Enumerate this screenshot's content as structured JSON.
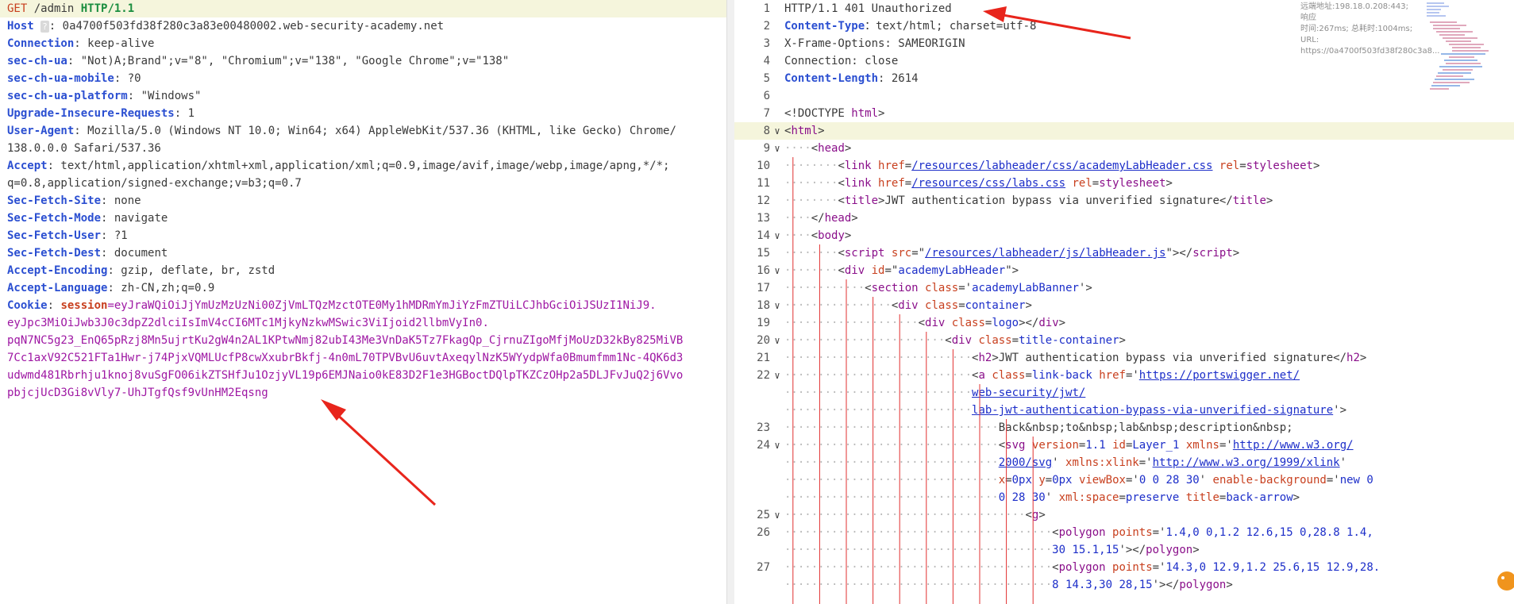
{
  "request": {
    "lines": [
      {
        "type": "reqline",
        "method": "GET",
        "path": " /admin ",
        "proto": "HTTP/1.1"
      },
      {
        "type": "host",
        "key": "Host",
        "badge": "?",
        "value": ": 0a4700f503fd38f280c3a83e00480002.web-security-academy.net"
      },
      {
        "type": "header",
        "key": "Connection",
        "value": ": keep-alive"
      },
      {
        "type": "header",
        "key": "sec-ch-ua",
        "value": ": \"Not)A;Brand\";v=\"8\", \"Chromium\";v=\"138\", \"Google Chrome\";v=\"138\""
      },
      {
        "type": "header",
        "key": "sec-ch-ua-mobile",
        "value": ": ?0"
      },
      {
        "type": "header",
        "key": "sec-ch-ua-platform",
        "value": ": \"Windows\""
      },
      {
        "type": "header",
        "key": "Upgrade-Insecure-Requests",
        "value": ": 1"
      },
      {
        "type": "header",
        "key": "User-Agent",
        "value": ": Mozilla/5.0 (Windows NT 10.0; Win64; x64) AppleWebKit/537.36 (KHTML, like Gecko) Chrome/"
      },
      {
        "type": "cont",
        "value": "138.0.0.0 Safari/537.36"
      },
      {
        "type": "header",
        "key": "Accept",
        "value": ": text/html,application/xhtml+xml,application/xml;q=0.9,image/avif,image/webp,image/apng,*/*;"
      },
      {
        "type": "cont",
        "value": "q=0.8,application/signed-exchange;v=b3;q=0.7"
      },
      {
        "type": "header",
        "key": "Sec-Fetch-Site",
        "value": ": none"
      },
      {
        "type": "header",
        "key": "Sec-Fetch-Mode",
        "value": ": navigate"
      },
      {
        "type": "header",
        "key": "Sec-Fetch-User",
        "value": ": ?1"
      },
      {
        "type": "header",
        "key": "Sec-Fetch-Dest",
        "value": ": document"
      },
      {
        "type": "header",
        "key": "Accept-Encoding",
        "value": ": gzip, deflate, br, zstd"
      },
      {
        "type": "header",
        "key": "Accept-Language",
        "value": ": zh-CN,zh;q=0.9"
      },
      {
        "type": "cookie",
        "key": "Cookie",
        "sep": ": ",
        "cname": "session",
        "value": "=eyJraWQiOiJjYmUzMzUzNi00ZjVmLTQzMzctOTE0My1hMDRmYmJiYzFmZTUiLCJhbGciOiJSUzI1NiJ9."
      },
      {
        "type": "payload",
        "value": "eyJpc3MiOiJwb3J0c3dpZ2dlciIsImV4cCI6MTc1MjkyNzkwMSwic3ViIjoid2llbmVyIn0."
      },
      {
        "type": "payload",
        "value": "pqN7NC5g23_EnQ65pRzj8Mn5ujrtKu2gW4n2AL1KPtwNmj82ubI43Me3VnDaK5Tz7FkagQp_CjrnuZIgoMfjMoUzD32kBy825MiVB"
      },
      {
        "type": "payload",
        "value": "7Cc1axV92C521FTa1Hwr-j74PjxVQMLUcfP8cwXxubrBkfj-4n0mL70TPVBvU6uvtAxeqylNzK5WYydpWfa0Bmumfmm1Nc-4QK6d3"
      },
      {
        "type": "payload",
        "value": "udwmd481Rbrhju1knoj8vuSgFO06ikZTSHfJu1OzjyVL19p6EMJNaio0kE83D2F1e3HGBoctDQlpTKZCzOHp2a5DLJFvJuQ2j6Vvo"
      },
      {
        "type": "payload",
        "value": "pbjcjUcD3Gi8vVly7-UhJTgfQsf9vUnHM2Eqsng"
      }
    ]
  },
  "response": {
    "tip": [
      "远端地址:198.18.0.208:443; 响应",
      "时间:267ms; 总耗时:1004ms; URL:",
      "https://0a4700f503fd38f280c3a8..."
    ],
    "lines": [
      {
        "n": "1",
        "fold": "",
        "indent": 0,
        "html": "HTTP/1.1 401 Unauthorized"
      },
      {
        "n": "2",
        "fold": "",
        "indent": 0,
        "parts": [
          [
            "hk",
            "Content-Type"
          ],
          [
            "",
            "："
          ],
          [
            "",
            "text/html; charset=utf-8"
          ]
        ]
      },
      {
        "n": "3",
        "fold": "",
        "indent": 0,
        "html": "X-Frame-Options: SAMEORIGIN"
      },
      {
        "n": "4",
        "fold": "",
        "indent": 0,
        "html": "Connection: close"
      },
      {
        "n": "5",
        "fold": "",
        "indent": 0,
        "parts": [
          [
            "hk",
            "Content-Length"
          ],
          [
            "",
            ": 2614"
          ]
        ]
      },
      {
        "n": "6",
        "fold": "",
        "indent": 0,
        "html": ""
      },
      {
        "n": "7",
        "fold": "",
        "indent": 0,
        "parts": [
          [
            "",
            "<!DOCTYPE "
          ],
          [
            "tag",
            "html"
          ],
          [
            "",
            ">"
          ]
        ]
      },
      {
        "n": "8",
        "fold": "v",
        "indent": 0,
        "hl": true,
        "parts": [
          [
            "",
            "<"
          ],
          [
            "tag",
            "html"
          ],
          [
            "",
            ">"
          ]
        ]
      },
      {
        "n": "9",
        "fold": "v",
        "indent": 1,
        "parts": [
          [
            "",
            "<"
          ],
          [
            "tag",
            "head"
          ],
          [
            "",
            ">"
          ]
        ]
      },
      {
        "n": "10",
        "fold": "",
        "indent": 2,
        "parts": [
          [
            "",
            "<"
          ],
          [
            "tag",
            "link"
          ],
          [
            "",
            " "
          ],
          [
            "attr",
            "href"
          ],
          [
            "",
            "="
          ],
          [
            "link",
            "/resources/labheader/css/academyLabHeader.css"
          ],
          [
            "",
            " "
          ],
          [
            "attr",
            "rel"
          ],
          [
            "",
            "="
          ],
          [
            "tag",
            "stylesheet"
          ],
          [
            "",
            ">"
          ]
        ]
      },
      {
        "n": "11",
        "fold": "",
        "indent": 2,
        "parts": [
          [
            "",
            "<"
          ],
          [
            "tag",
            "link"
          ],
          [
            "",
            " "
          ],
          [
            "attr",
            "href"
          ],
          [
            "",
            "="
          ],
          [
            "link",
            "/resources/css/labs.css"
          ],
          [
            "",
            " "
          ],
          [
            "attr",
            "rel"
          ],
          [
            "",
            "="
          ],
          [
            "tag",
            "stylesheet"
          ],
          [
            "",
            ">"
          ]
        ]
      },
      {
        "n": "12",
        "fold": "",
        "indent": 2,
        "parts": [
          [
            "",
            "<"
          ],
          [
            "tag",
            "title"
          ],
          [
            "",
            ">JWT authentication bypass via unverified signature</"
          ],
          [
            "tag",
            "title"
          ],
          [
            "",
            ">"
          ]
        ]
      },
      {
        "n": "13",
        "fold": "",
        "indent": 1,
        "parts": [
          [
            "",
            "</"
          ],
          [
            "tag",
            "head"
          ],
          [
            "",
            ">"
          ]
        ]
      },
      {
        "n": "14",
        "fold": "v",
        "indent": 1,
        "parts": [
          [
            "",
            "<"
          ],
          [
            "tag",
            "body"
          ],
          [
            "",
            ">"
          ]
        ]
      },
      {
        "n": "15",
        "fold": "",
        "indent": 2,
        "parts": [
          [
            "",
            "<"
          ],
          [
            "tag",
            "script"
          ],
          [
            "",
            " "
          ],
          [
            "attr",
            "src"
          ],
          [
            "",
            "=\""
          ],
          [
            "link",
            "/resources/labheader/js/labHeader.js"
          ],
          [
            "",
            "\"></"
          ],
          [
            "tag",
            "script"
          ],
          [
            "",
            ">"
          ]
        ]
      },
      {
        "n": "16",
        "fold": "v",
        "indent": 2,
        "parts": [
          [
            "",
            "<"
          ],
          [
            "tag",
            "div"
          ],
          [
            "",
            " "
          ],
          [
            "attr",
            "id"
          ],
          [
            "",
            "=\""
          ],
          [
            "val",
            "academyLabHeader"
          ],
          [
            "",
            "\">"
          ]
        ]
      },
      {
        "n": "17",
        "fold": "",
        "indent": 3,
        "parts": [
          [
            "",
            "<"
          ],
          [
            "tag",
            "section"
          ],
          [
            "",
            " "
          ],
          [
            "attr",
            "class"
          ],
          [
            "",
            "='"
          ],
          [
            "val",
            "academyLabBanner"
          ],
          [
            "",
            "'>"
          ]
        ]
      },
      {
        "n": "18",
        "fold": "v",
        "indent": 4,
        "parts": [
          [
            "",
            "<"
          ],
          [
            "tag",
            "div"
          ],
          [
            "",
            " "
          ],
          [
            "attr",
            "class"
          ],
          [
            "",
            "="
          ],
          [
            "val",
            "container"
          ],
          [
            "",
            ">"
          ]
        ]
      },
      {
        "n": "19",
        "fold": "",
        "indent": 5,
        "parts": [
          [
            "",
            "<"
          ],
          [
            "tag",
            "div"
          ],
          [
            "",
            " "
          ],
          [
            "attr",
            "class"
          ],
          [
            "",
            "="
          ],
          [
            "val",
            "logo"
          ],
          [
            "",
            "></"
          ],
          [
            "tag",
            "div"
          ],
          [
            "",
            ">"
          ]
        ]
      },
      {
        "n": "20",
        "fold": "v",
        "indent": 6,
        "parts": [
          [
            "",
            "<"
          ],
          [
            "tag",
            "div"
          ],
          [
            "",
            " "
          ],
          [
            "attr",
            "class"
          ],
          [
            "",
            "="
          ],
          [
            "val",
            "title-container"
          ],
          [
            "",
            ">"
          ]
        ]
      },
      {
        "n": "21",
        "fold": "",
        "indent": 7,
        "parts": [
          [
            "",
            "<"
          ],
          [
            "tag",
            "h2"
          ],
          [
            "",
            ">JWT authentication bypass via unverified signature</"
          ],
          [
            "tag",
            "h2"
          ],
          [
            "",
            ">"
          ]
        ]
      },
      {
        "n": "22",
        "fold": "v",
        "indent": 7,
        "parts": [
          [
            "",
            "<"
          ],
          [
            "tag",
            "a"
          ],
          [
            "",
            " "
          ],
          [
            "attr",
            "class"
          ],
          [
            "",
            "="
          ],
          [
            "val",
            "link-back"
          ],
          [
            "",
            " "
          ],
          [
            "attr",
            "href"
          ],
          [
            "",
            "='"
          ],
          [
            "link",
            "https://portswigger.net/"
          ]
        ]
      },
      {
        "n": "",
        "fold": "",
        "indent": 7,
        "parts": [
          [
            "link",
            "web-security/jwt/"
          ]
        ]
      },
      {
        "n": "",
        "fold": "",
        "indent": 7,
        "parts": [
          [
            "link",
            "lab-jwt-authentication-bypass-via-unverified-signature"
          ],
          [
            "",
            "'>"
          ]
        ]
      },
      {
        "n": "23",
        "fold": "",
        "indent": 8,
        "html": "Back&nbsp;to&nbsp;lab&nbsp;description&nbsp;"
      },
      {
        "n": "24",
        "fold": "v",
        "indent": 8,
        "parts": [
          [
            "",
            "<"
          ],
          [
            "tag",
            "svg"
          ],
          [
            "",
            " "
          ],
          [
            "attr",
            "version"
          ],
          [
            "",
            "="
          ],
          [
            "val",
            "1.1"
          ],
          [
            "",
            " "
          ],
          [
            "attr",
            "id"
          ],
          [
            "",
            "="
          ],
          [
            "val",
            "Layer_1"
          ],
          [
            "",
            " "
          ],
          [
            "attr",
            "xmlns"
          ],
          [
            "",
            "='"
          ],
          [
            "link",
            "http://www.w3.org/"
          ]
        ]
      },
      {
        "n": "",
        "fold": "",
        "indent": 8,
        "parts": [
          [
            "link",
            "2000/svg"
          ],
          [
            "",
            "' "
          ],
          [
            "attr",
            "xmlns:xlink"
          ],
          [
            "",
            "='"
          ],
          [
            "link",
            "http://www.w3.org/1999/xlink"
          ],
          [
            "",
            "'"
          ]
        ]
      },
      {
        "n": "",
        "fold": "",
        "indent": 8,
        "parts": [
          [
            "attr",
            "x"
          ],
          [
            "",
            "="
          ],
          [
            "val",
            "0px"
          ],
          [
            "",
            " "
          ],
          [
            "attr",
            "y"
          ],
          [
            "",
            "="
          ],
          [
            "val",
            "0px"
          ],
          [
            "",
            " "
          ],
          [
            "attr",
            "viewBox"
          ],
          [
            "",
            "='"
          ],
          [
            "val",
            "0 0 28 30"
          ],
          [
            "",
            "' "
          ],
          [
            "attr",
            "enable-background"
          ],
          [
            "",
            "='"
          ],
          [
            "val",
            "new 0"
          ]
        ]
      },
      {
        "n": "",
        "fold": "",
        "indent": 8,
        "parts": [
          [
            "val",
            "0 28 30"
          ],
          [
            "",
            "' "
          ],
          [
            "attr",
            "xml:space"
          ],
          [
            "",
            "="
          ],
          [
            "val",
            "preserve"
          ],
          [
            "",
            " "
          ],
          [
            "attr",
            "title"
          ],
          [
            "",
            "="
          ],
          [
            "val",
            "back-arrow"
          ],
          [
            "",
            ">"
          ]
        ]
      },
      {
        "n": "25",
        "fold": "v",
        "indent": 9,
        "parts": [
          [
            "",
            "<"
          ],
          [
            "tag",
            "g"
          ],
          [
            "",
            ">"
          ]
        ]
      },
      {
        "n": "26",
        "fold": "",
        "indent": 10,
        "parts": [
          [
            "",
            "<"
          ],
          [
            "tag",
            "polygon"
          ],
          [
            "",
            " "
          ],
          [
            "attr",
            "points"
          ],
          [
            "",
            "='"
          ],
          [
            "val",
            "1.4,0 0,1.2 12.6,15 0,28.8 1.4,"
          ]
        ]
      },
      {
        "n": "",
        "fold": "",
        "indent": 10,
        "parts": [
          [
            "val",
            "30 15.1,15"
          ],
          [
            "",
            "'></"
          ],
          [
            "tag",
            "polygon"
          ],
          [
            "",
            ">"
          ]
        ]
      },
      {
        "n": "27",
        "fold": "",
        "indent": 10,
        "parts": [
          [
            "",
            "<"
          ],
          [
            "tag",
            "polygon"
          ],
          [
            "",
            " "
          ],
          [
            "attr",
            "points"
          ],
          [
            "",
            "='"
          ],
          [
            "val",
            "14.3,0 12.9,1.2 25.6,15 12.9,28."
          ]
        ]
      },
      {
        "n": "",
        "fold": "",
        "indent": 10,
        "parts": [
          [
            "val",
            "8 14.3,30 28,15"
          ],
          [
            "",
            "'></"
          ],
          [
            "tag",
            "polygon"
          ],
          [
            "",
            ">"
          ]
        ]
      }
    ]
  },
  "colors": {
    "arrow": "#e8251c",
    "highlight": "#f5f5dc"
  }
}
